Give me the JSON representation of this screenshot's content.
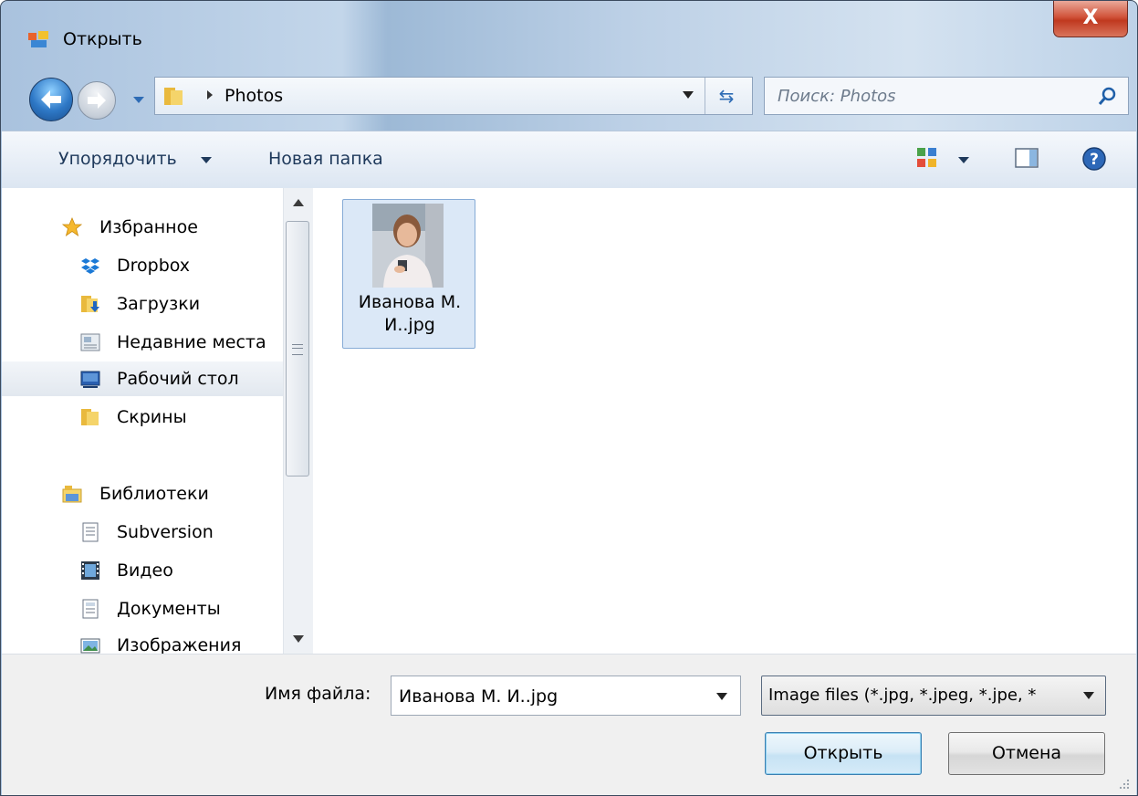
{
  "window": {
    "title": "Открыть",
    "close_label": "X"
  },
  "address": {
    "path": "Photos"
  },
  "search": {
    "placeholder": "Поиск: Photos"
  },
  "toolbar": {
    "organize_label": "Упорядочить",
    "new_folder_label": "Новая папка"
  },
  "nav": {
    "items": [
      {
        "label": "Избранное",
        "icon": "star-icon"
      },
      {
        "label": "Dropbox",
        "icon": "dropbox-icon"
      },
      {
        "label": "Загрузки",
        "icon": "downloads-folder-icon"
      },
      {
        "label": "Недавние места",
        "icon": "recent-places-icon"
      },
      {
        "label": "Рабочий стол",
        "icon": "desktop-icon",
        "selected": true
      },
      {
        "label": "Скрины",
        "icon": "folder-icon"
      },
      {
        "label": "Библиотеки",
        "icon": "libraries-icon"
      },
      {
        "label": "Subversion",
        "icon": "document-icon"
      },
      {
        "label": "Видео",
        "icon": "video-icon"
      },
      {
        "label": "Документы",
        "icon": "documents-icon"
      },
      {
        "label": "Изображения",
        "icon": "pictures-icon"
      }
    ]
  },
  "files": [
    {
      "name": "Иванова М. И..jpg",
      "icon": "photo-thumbnail-icon",
      "selected": true
    }
  ],
  "bottom": {
    "file_name_label": "Имя файла:",
    "file_name_value": "Иванова М. И..jpg",
    "file_type_value": "Image files (*.jpg, *.jpeg, *.jpe, *",
    "open_label": "Открыть",
    "cancel_label": "Отмена"
  },
  "colors": {
    "accent": "#2e78c6",
    "selection": "#dbe8f7",
    "close": "#c0391f"
  }
}
